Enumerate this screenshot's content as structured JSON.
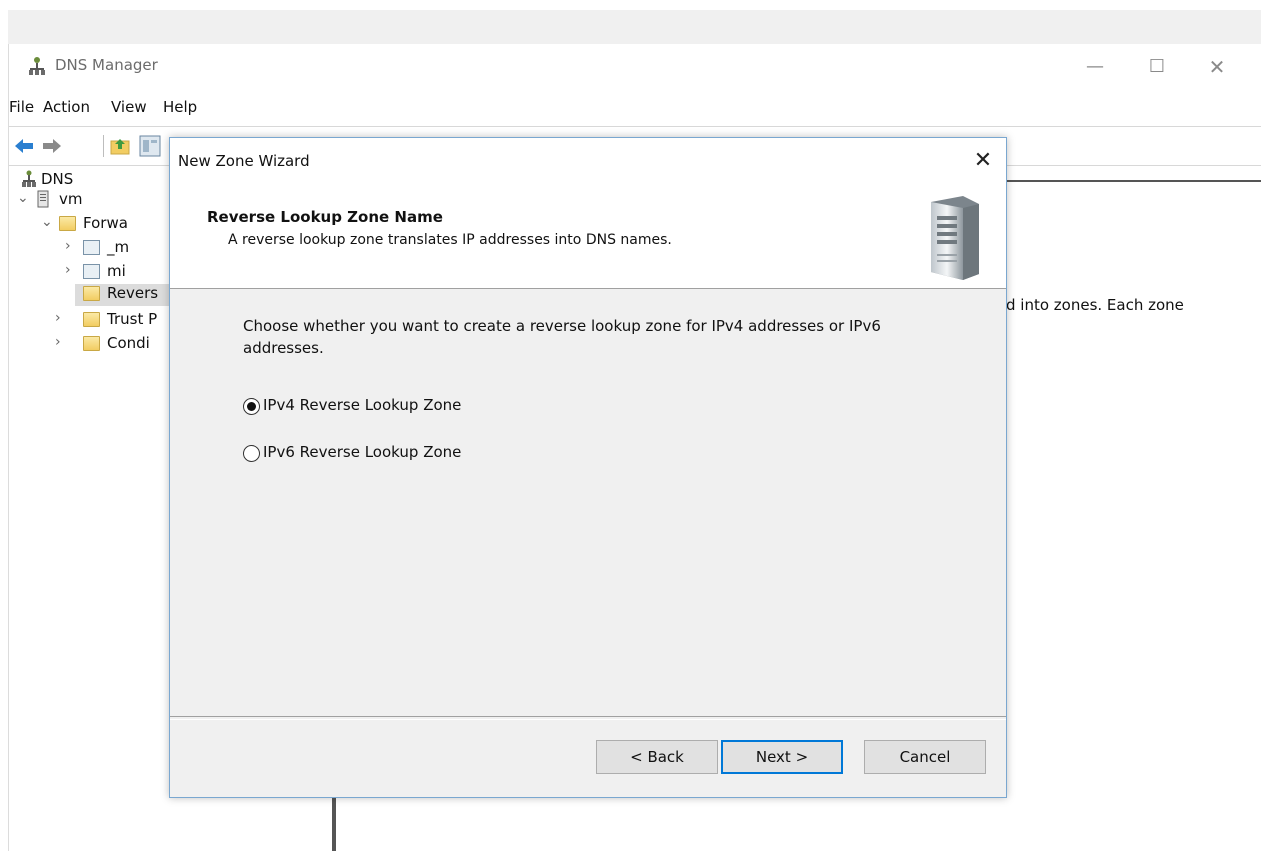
{
  "window": {
    "title": "DNS Manager",
    "minimize": "—",
    "maximize": "☐",
    "close": "✕"
  },
  "menu": [
    "File",
    "Action",
    "View",
    "Help"
  ],
  "toolbar": {
    "buttons": [
      "back-arrow-icon",
      "forward-arrow-icon",
      "up-folder-icon",
      "show-console-tree-icon"
    ]
  },
  "tree": {
    "root": "DNS",
    "server": "vm",
    "forward": "Forwa",
    "zone1": "_m",
    "zone2": "mi",
    "reverse": "Revers",
    "trust": "Trust P",
    "conditional": "Condi"
  },
  "right_pane": {
    "text": "d into zones. Each zone"
  },
  "wizard": {
    "title": "New Zone Wizard",
    "close": "✕",
    "header_title": "Reverse Lookup Zone Name",
    "header_subtitle": "A reverse lookup zone translates IP addresses into DNS names.",
    "instruction": "Choose whether you want to create a reverse lookup zone for IPv4 addresses or IPv6 addresses.",
    "options": [
      {
        "label": "IPv4 Reverse Lookup Zone",
        "checked": true
      },
      {
        "label": "IPv6 Reverse Lookup Zone",
        "checked": false
      }
    ],
    "buttons": {
      "back": "< Back",
      "next": "Next >",
      "cancel": "Cancel"
    }
  },
  "colors": {
    "accent": "#0078d7",
    "dialog_bg": "#f0f0f0",
    "dialog_border": "#7aa7d0"
  }
}
